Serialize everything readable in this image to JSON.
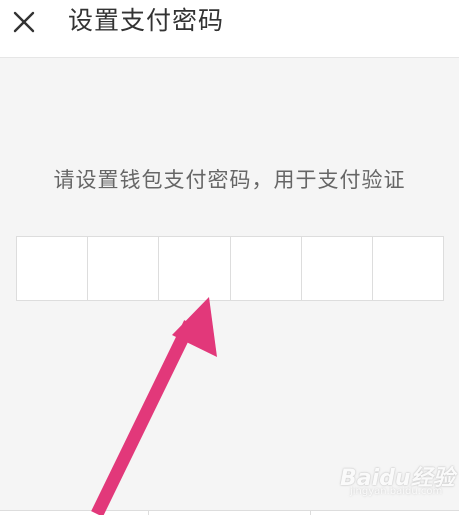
{
  "header": {
    "title": "设置支付密码",
    "close_icon": "close-icon"
  },
  "instruction": "请设置钱包支付密码，用于支付验证",
  "pin": {
    "length": 6,
    "digits": [
      "",
      "",
      "",
      "",
      "",
      ""
    ]
  },
  "annotation": {
    "arrow_color": "#e2387a",
    "icon": "pointer-arrow"
  },
  "watermark": {
    "brand": "Baidu经验",
    "site": "jingyan.baidu.com"
  },
  "colors": {
    "background": "#f5f5f5",
    "header_background": "#ffffff",
    "border": "#dddddd",
    "title_text": "#333333",
    "instruction_text": "#666666"
  }
}
